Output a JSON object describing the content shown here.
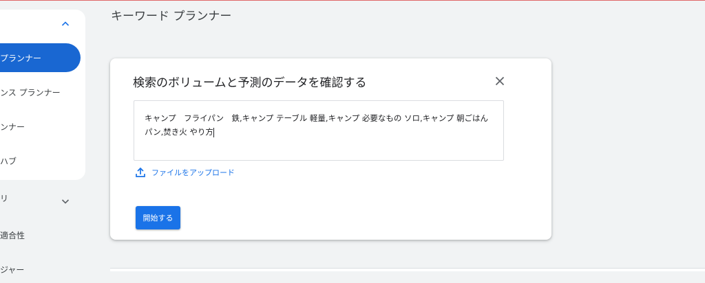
{
  "page": {
    "title": "キーワード プランナー"
  },
  "sidebar": {
    "items": [
      {
        "label": "プランナー"
      },
      {
        "label": "ンス プランナー"
      },
      {
        "label": "ンナー"
      },
      {
        "label": "ハブ"
      }
    ],
    "section": {
      "label": "リ"
    },
    "more": [
      {
        "label": "適合性"
      },
      {
        "label": "ジャー"
      }
    ]
  },
  "dialog": {
    "title": "検索のボリュームと予測のデータを確認する",
    "keywords_value": "キャンプ　フライパン　鉄,キャンプ テーブル 軽量,キャンプ 必要なもの ソロ,キャンプ 朝ごはん パン,焚き火 やり方",
    "upload_label": "ファイルをアップロード",
    "start_label": "開始する"
  },
  "colors": {
    "accent": "#1a73e8",
    "active_nav": "#1967d2",
    "background": "#f1f3f4"
  },
  "icons": {
    "collapse": "chevron-up-icon",
    "expand": "chevron-down-icon",
    "close": "close-icon",
    "upload": "upload-icon"
  }
}
